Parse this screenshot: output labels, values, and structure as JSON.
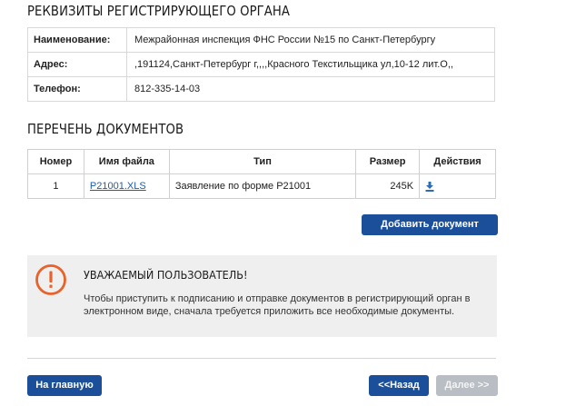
{
  "registrar": {
    "title": "РЕКВИЗИТЫ РЕГИСТРИРУЮЩЕГО ОРГАНА",
    "rows": [
      {
        "label": "Наименование:",
        "value": "Межрайонная инспекция ФНС России №15 по Санкт-Петербургу"
      },
      {
        "label": "Адрес:",
        "value": ",191124,Санкт-Петербург г,,,,Красного Текстильщика ул,10-12 лит.О,,"
      },
      {
        "label": "Телефон:",
        "value": "812-335-14-03"
      }
    ]
  },
  "documents": {
    "title": "ПЕРЕЧЕНЬ ДОКУМЕНТОВ",
    "columns": [
      "Номер",
      "Имя файла",
      "Тип",
      "Размер",
      "Действия"
    ],
    "rows": [
      {
        "number": "1",
        "file": "P21001.XLS",
        "type": "Заявление по форме Р21001",
        "size": "245K",
        "action_icon": "download-icon"
      }
    ],
    "add_button": "Добавить документ"
  },
  "notice": {
    "icon": "warning-icon",
    "title": "УВАЖАЕМЫЙ ПОЛЬЗОВАТЕЛЬ!",
    "text": "Чтобы приступить к подписанию и отправке документов в регистрирующий орган в электронном виде, сначала требуется приложить все необходимые документы."
  },
  "footer": {
    "home": "На главную",
    "back": "<<Назад",
    "next": "Далее >>"
  },
  "colors": {
    "primary_button": "#1b4f9a",
    "disabled_button": "#b9bec5",
    "warning": "#e8632c",
    "link": "#1a5ea8"
  }
}
